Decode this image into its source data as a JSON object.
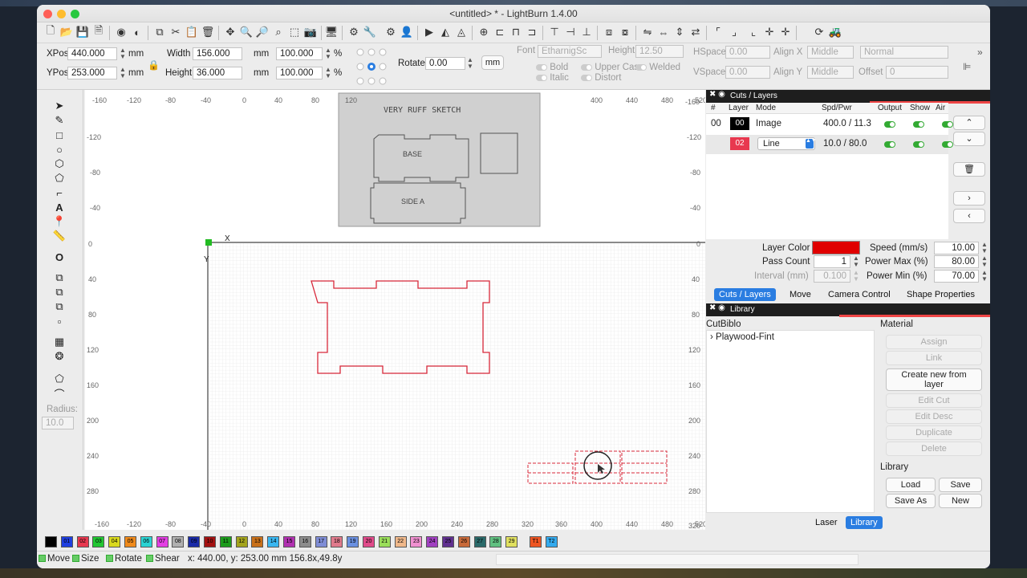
{
  "window": {
    "title": "<untitled> * - LightBurn 1.4.00"
  },
  "props": {
    "xpos_label": "XPos",
    "xpos_value": "440.000",
    "ypos_label": "YPos",
    "ypos_value": "253.000",
    "unit": "mm",
    "width_label": "Width",
    "width_value": "156.000",
    "height_label": "Height",
    "height_value": "36.000",
    "scale_w": "100.000",
    "scale_h": "100.000",
    "pct": "%",
    "rotate_label": "Rotate",
    "rotate_value": "0.00",
    "mm_button": "mm",
    "font_label": "Font",
    "font_value": "EtharnigSc",
    "font_height_label": "Height",
    "font_height_value": "12.50",
    "hspace_label": "HSpace",
    "hspace_value": "0.00",
    "vspace_label": "VSpace",
    "vspace_value": "0.00",
    "alignx_label": "Align X",
    "alignx_value": "Middle",
    "aligny_label": "Align Y",
    "aligny_value": "Middle",
    "normal_value": "Normal",
    "offset_label": "Offset",
    "offset_value": "0",
    "bold": "Bold",
    "italic": "Italic",
    "upper_case": "Upper Case",
    "distort": "Distort",
    "welded": "Welded"
  },
  "rulers": {
    "top": [
      "-120",
      "-80",
      "-40",
      "0",
      "40",
      "80",
      "120",
      "160",
      "200",
      "240",
      "280",
      "320",
      "360",
      "400",
      "440",
      "480",
      "520"
    ],
    "top_start": "-160",
    "left": [
      "-120",
      "-80",
      "-40",
      "0",
      "40",
      "80",
      "120",
      "160",
      "200",
      "240",
      "280",
      "320"
    ],
    "left_start": "-160",
    "right": [
      "-160",
      "-120",
      "-80",
      "-40",
      "0",
      "40",
      "80",
      "120",
      "160",
      "200",
      "240",
      "280",
      "320"
    ],
    "axis_x": "X",
    "axis_y": "Y"
  },
  "sketch": {
    "title_text": "VERY RUFF SKETCH",
    "base_text": "BASE",
    "side_text": "SIDE A"
  },
  "left_tools": {
    "radius_label": "Radius:",
    "radius_value": "10.0"
  },
  "cuts": {
    "panel_title": "Cuts / Layers",
    "headers": [
      "#",
      "Layer",
      "Mode",
      "Spd/Pwr",
      "Output",
      "Show",
      "Air"
    ],
    "rows": [
      {
        "num": "00",
        "layer": "00",
        "layer_color": "#000000",
        "mode": "Image",
        "spd": "400.0 / 11.3"
      },
      {
        "num": "",
        "layer": "02",
        "layer_color": "#e8384f",
        "mode": "Line",
        "spd": "10.0 / 80.0"
      }
    ],
    "layer_color_label": "Layer Color",
    "layer_color_value": "#e00000",
    "pass_count_label": "Pass Count",
    "pass_count_value": "1",
    "interval_label": "Interval (mm)",
    "interval_value": "0.100",
    "speed_label": "Speed (mm/s)",
    "speed_value": "10.00",
    "pmax_label": "Power Max (%)",
    "pmax_value": "80.00",
    "pmin_label": "Power Min (%)",
    "pmin_value": "70.00"
  },
  "tabs": [
    "Cuts / Layers",
    "Move",
    "Camera Control",
    "Shape Properties"
  ],
  "library": {
    "panel_title": "Library",
    "tree_header": "CutBiblo",
    "tree_item": "Playwood-Fint",
    "material_label": "Material",
    "buttons": [
      "Assign",
      "Link",
      "Create new from layer",
      "Edit Cut",
      "Edit Desc",
      "Duplicate",
      "Delete"
    ],
    "library_label": "Library",
    "load": "Load",
    "save": "Save",
    "save_as": "Save As",
    "new": "New"
  },
  "bottom_tabs": [
    "Laser",
    "Library"
  ],
  "palette": [
    {
      "n": "00",
      "c": "#000000"
    },
    {
      "n": "01",
      "c": "#1f3fe0"
    },
    {
      "n": "02",
      "c": "#e8384f"
    },
    {
      "n": "03",
      "c": "#22c733"
    },
    {
      "n": "04",
      "c": "#d9d91e"
    },
    {
      "n": "05",
      "c": "#f08a1b"
    },
    {
      "n": "06",
      "c": "#2ad3d3"
    },
    {
      "n": "07",
      "c": "#e33ee3"
    },
    {
      "n": "08",
      "c": "#b0b0b0"
    },
    {
      "n": "09",
      "c": "#1a2ba8"
    },
    {
      "n": "10",
      "c": "#a31111"
    },
    {
      "n": "11",
      "c": "#1c9b1c"
    },
    {
      "n": "12",
      "c": "#a3a31c"
    },
    {
      "n": "13",
      "c": "#c8701a"
    },
    {
      "n": "14",
      "c": "#3ab6f0"
    },
    {
      "n": "15",
      "c": "#b030b0"
    },
    {
      "n": "16",
      "c": "#8c8c8c"
    },
    {
      "n": "17",
      "c": "#7f8dd6"
    },
    {
      "n": "18",
      "c": "#e07a8c"
    },
    {
      "n": "19",
      "c": "#6a90e0"
    },
    {
      "n": "20",
      "c": "#e04a8a"
    },
    {
      "n": "21",
      "c": "#9ade5a"
    },
    {
      "n": "22",
      "c": "#f0b88a"
    },
    {
      "n": "23",
      "c": "#f090d0"
    },
    {
      "n": "24",
      "c": "#a040c0"
    },
    {
      "n": "25",
      "c": "#603090"
    },
    {
      "n": "26",
      "c": "#c86a3a"
    },
    {
      "n": "27",
      "c": "#2a6a6a"
    },
    {
      "n": "28",
      "c": "#60c080"
    },
    {
      "n": "29",
      "c": "#e0e060"
    },
    {
      "n": "T1",
      "c": "#ee5522"
    },
    {
      "n": "T2",
      "c": "#33aaee"
    }
  ],
  "status": {
    "move": "Move",
    "size": "Size",
    "rotate": "Rotate",
    "shear": "Shear",
    "coords": "x: 440.00, y: 253.00 mm  156.8x,49.8y"
  }
}
